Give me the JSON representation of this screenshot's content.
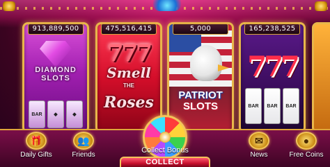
{
  "machines": [
    {
      "jackpot": "913,889,500",
      "title": "DIAMOND SLOTS",
      "reel_symbol": "BAR"
    },
    {
      "jackpot": "475,516,415",
      "symbol": "777",
      "title_line1": "Smell",
      "title_line2": "THE",
      "title_line3": "Roses"
    },
    {
      "jackpot": "5,000",
      "title_line1": "PATRIOT",
      "title_line2": "SLOTS"
    },
    {
      "jackpot": "165,238,525",
      "symbol": "777",
      "reel_symbol": "BAR"
    }
  ],
  "bottom_nav": {
    "daily_gifts": "Daily Gifts",
    "friends": "Friends",
    "news": "News",
    "free_coins": "Free Coins",
    "collect_bonus": "Collect Bonus",
    "collect": "COLLECT"
  },
  "icons": {
    "daily_gifts": "gift-icon",
    "friends": "friends-icon",
    "news": "envelope-icon",
    "free_coins": "coin-icon",
    "bonus_wheel": "bonus-wheel-icon"
  },
  "colors": {
    "frame_gold": "#e8b64a",
    "background": "#7a0a3e",
    "collect_red": "#c8102e"
  }
}
